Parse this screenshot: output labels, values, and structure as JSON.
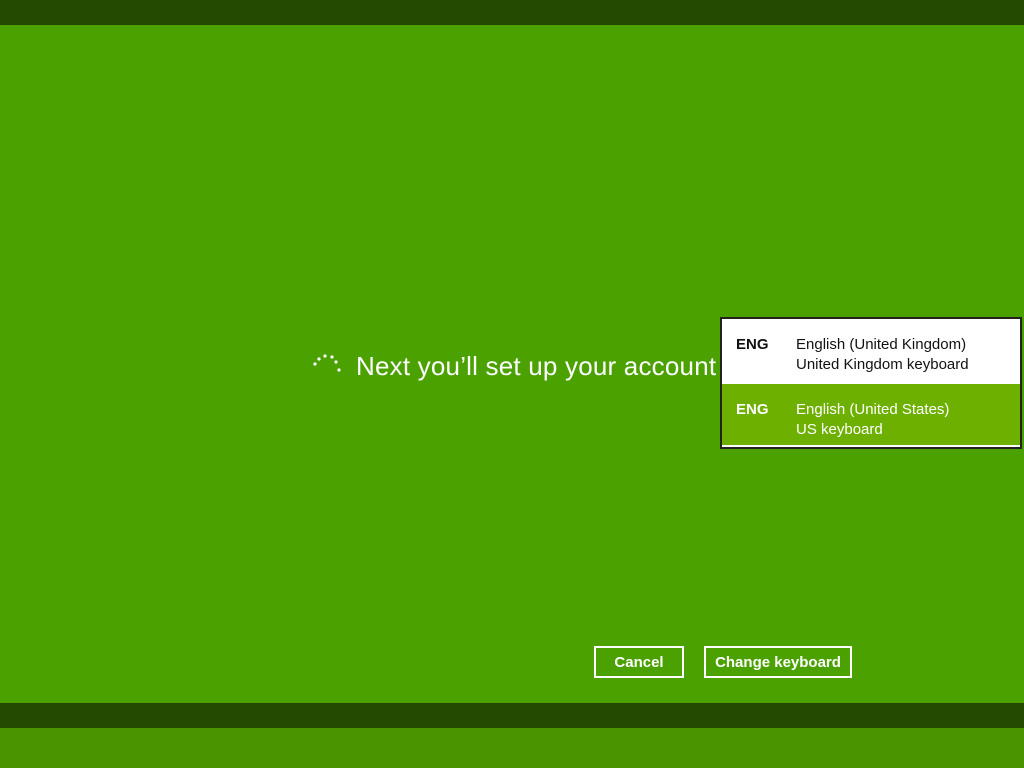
{
  "setup": {
    "status_text": "Next you’ll set up your account",
    "spinner_icon": "loading-dots-icon"
  },
  "keyboard_menu": {
    "items": [
      {
        "code": "ENG",
        "language": "English (United Kingdom)",
        "layout": "United Kingdom keyboard",
        "selected": false
      },
      {
        "code": "ENG",
        "language": "English (United States)",
        "layout": "US keyboard",
        "selected": true
      }
    ]
  },
  "buttons": {
    "cancel_label": "Cancel",
    "change_keyboard_label": "Change keyboard"
  },
  "colors": {
    "background": "#4aa100",
    "band": "#234a00",
    "selected_item": "#6db000",
    "text": "#ffffff"
  }
}
